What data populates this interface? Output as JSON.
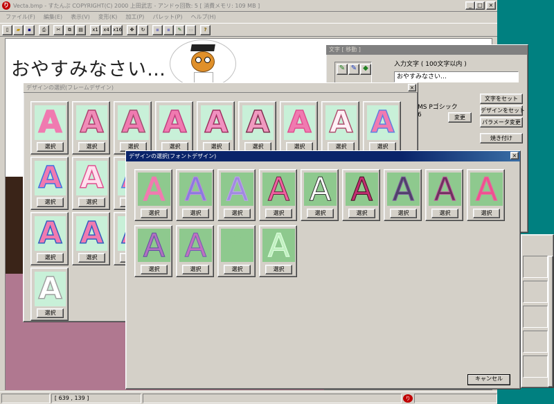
{
  "main": {
    "title": "Vecta.bmp - すたんぷ COPYRIGHT(C) 2000 上田武志 - アンドゥ回数: 5 [ 消費メモリ: 109 MB ]",
    "menus": [
      "ファイル(F)",
      "編集(E)",
      "表示(V)",
      "変形(K)",
      "加工(P)",
      "パレット(P)",
      "ヘルプ(H)"
    ],
    "window_buttons": [
      "_",
      "□",
      "×"
    ],
    "toolbar": {
      "x1": "x1",
      "x4": "x4",
      "x16": "x16",
      "help": "?"
    },
    "canvas_text": "おやすみなさい…",
    "status": {
      "coords": "[ 639 , 139 ]"
    }
  },
  "text_dialog": {
    "title": "文字 [ 移動 ]",
    "input_label": "入力文字 ( 100文字以内 )",
    "input_value": "おやすみなさい…",
    "font_name": "MS Pゴシック",
    "font_size": "6",
    "change_button": "変更",
    "set_text_button": "文字をセット",
    "set_design_button": "デザインをセット",
    "change_param_button": "パラメータ変更",
    "bake_button": "焼き付け"
  },
  "frame_dialog": {
    "title": "デザインの選択(フレームデザイン)",
    "close": "×",
    "glyph": "A",
    "pick_label": "選択",
    "rows": [
      [
        {
          "bg": "#c8f0d8",
          "fg": "#f07ab0",
          "st": "#f07ab0"
        },
        {
          "bg": "#c8f0d8",
          "fg": "#f08cb8",
          "st": "#b04070"
        },
        {
          "bg": "#c8f0d8",
          "fg": "#f07ab0",
          "st": "#a05070"
        },
        {
          "bg": "#c8f0d8",
          "fg": "#f07ab0",
          "st": "#c04080"
        },
        {
          "bg": "#c8f0d8",
          "fg": "#f090c0",
          "st": "#a03060"
        },
        {
          "bg": "#c8f0d8",
          "fg": "#f09ac0",
          "st": "#803050"
        },
        {
          "bg": "#c8f0d8",
          "fg": "#f07ab0",
          "st": "#e05090"
        },
        {
          "bg": "#c8f0d8",
          "fg": "#fff0f6",
          "st": "#b05070"
        },
        {
          "bg": "#c8f0d8",
          "fg": "#f07ab0",
          "st": "#6080e0"
        }
      ],
      [
        {
          "bg": "#c8f0d8",
          "fg": "#f07ab0",
          "st": "#4070e0"
        },
        {
          "bg": "#c8f0d8",
          "fg": "#ffe0ee",
          "st": "#e05090"
        },
        {
          "bg": "#c8f0d8",
          "fg": "#f07ab0",
          "st": "#5080e0"
        }
      ],
      [
        {
          "bg": "#c8f0d8",
          "fg": "#f07ab0",
          "st": "#3060c0"
        },
        {
          "bg": "#c8f0d8",
          "fg": "#f07ab0",
          "st": "#3060c0"
        },
        {
          "bg": "#c8f0d8",
          "fg": "#f07ab0",
          "st": "#3060c0"
        }
      ],
      [
        {
          "bg": "#c8f0d8",
          "fg": "#ffffff",
          "st": "#a0a0a0"
        }
      ]
    ]
  },
  "font_dialog": {
    "title": "デザインの選択(フォントデザイン)",
    "close": "×",
    "glyph": "A",
    "pick_label": "選択",
    "cancel_label": "キャンセル",
    "rows": [
      [
        {
          "fg": "#f07ab0",
          "st": "#f07ab0"
        },
        {
          "fg": "#8a7ae0",
          "st": "#c088e0"
        },
        {
          "fg": "#a08ae0",
          "st": "#c0a0f0"
        },
        {
          "fg": "#f060a0",
          "st": "#6a2040"
        },
        {
          "fg": "#ffffff",
          "st": "#303030"
        },
        {
          "fg": "#c03070",
          "st": "#401020"
        },
        {
          "fg": "#50406a",
          "st": "#8060a0"
        },
        {
          "fg": "#703060",
          "st": "#c060a0"
        },
        {
          "fg": "#f05090",
          "st": "#e070a0"
        }
      ],
      [
        {
          "fg": "#b070c0",
          "st": "#6050a0"
        },
        {
          "fg": "#c070c0",
          "st": "#7060b0"
        },
        {
          "fg": "#8ec98e",
          "st": "#8ec98e"
        },
        {
          "fg": "#c0f0c0",
          "st": "#e0ffe0"
        }
      ]
    ]
  }
}
